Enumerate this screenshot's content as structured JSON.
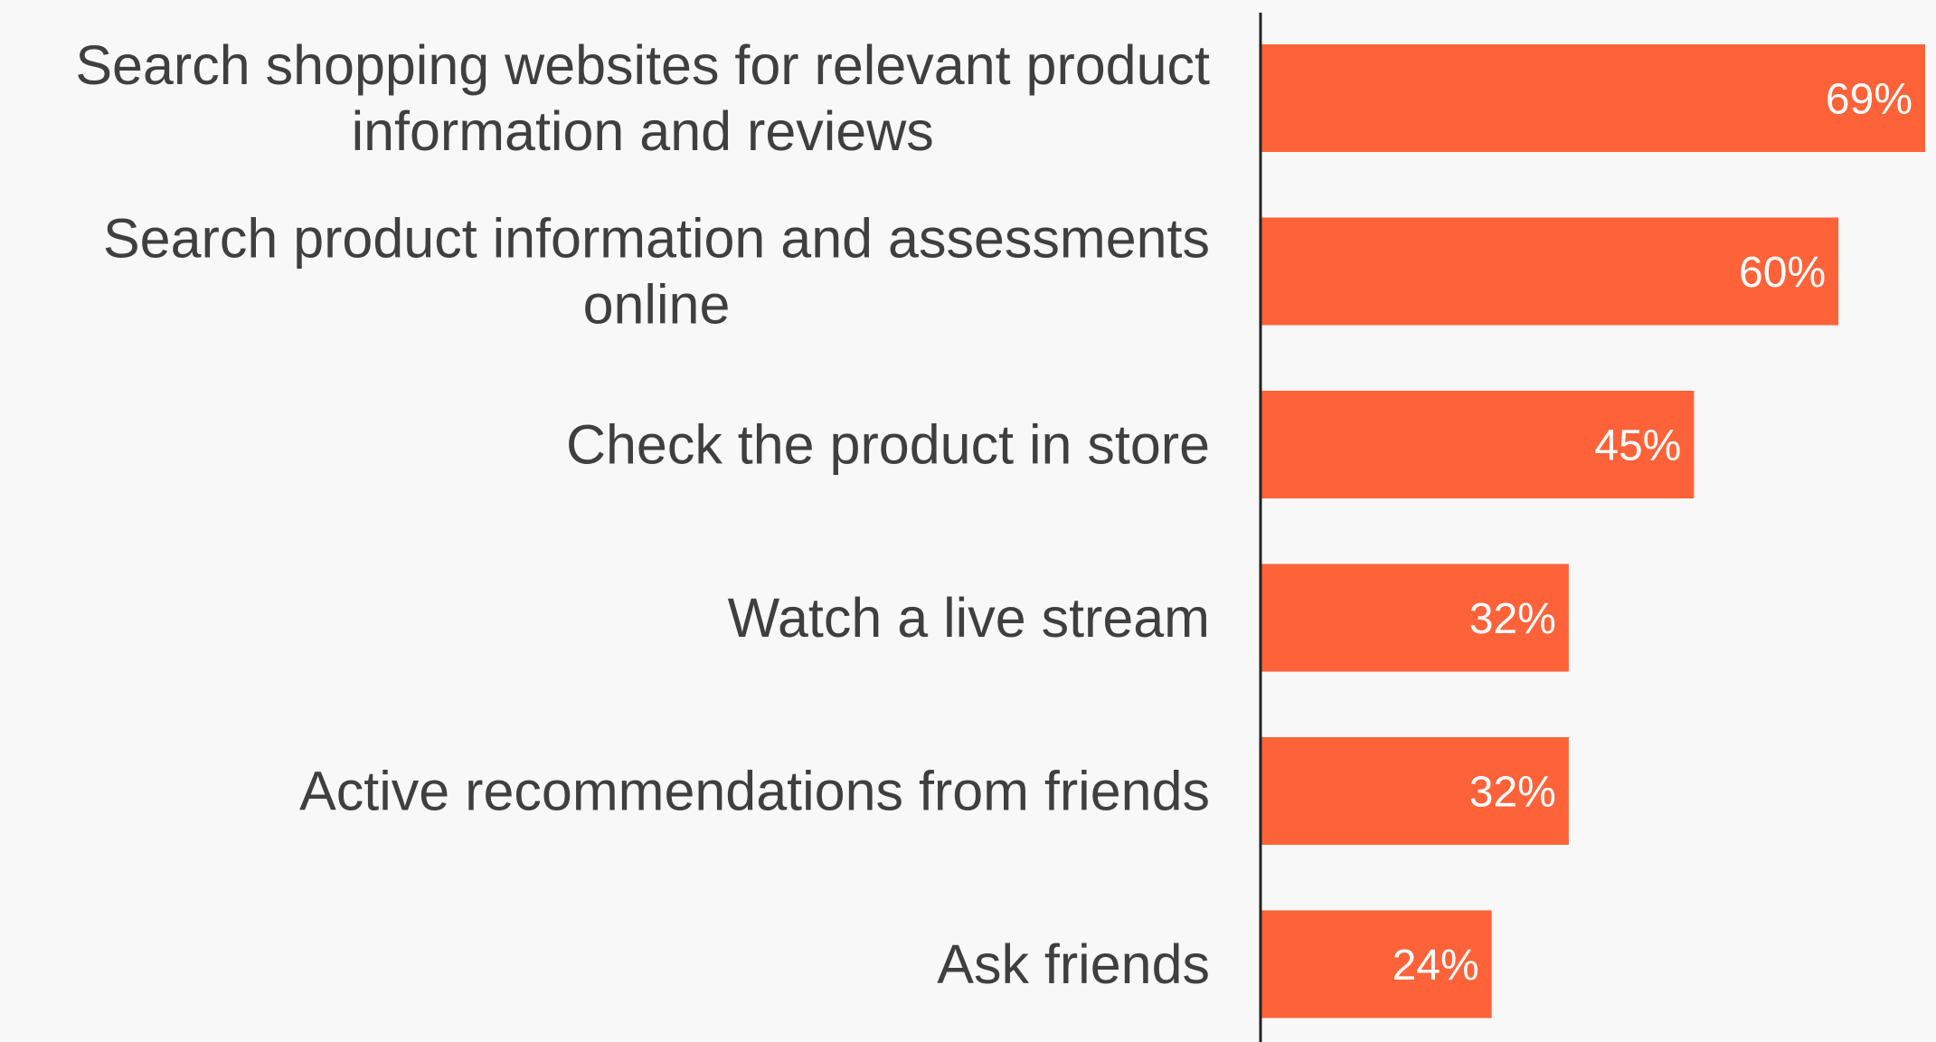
{
  "chart_data": {
    "type": "bar",
    "orientation": "horizontal",
    "categories": [
      [
        "Search shopping websites for relevant product",
        "information and reviews"
      ],
      [
        "Search product information and assessments",
        "online"
      ],
      [
        "Check the product in store"
      ],
      [
        "Watch a live stream"
      ],
      [
        "Active recommendations from friends"
      ],
      [
        "Ask friends"
      ]
    ],
    "values": [
      69,
      60,
      45,
      32,
      32,
      24
    ],
    "value_labels": [
      "69%",
      "60%",
      "45%",
      "32%",
      "32%",
      "24%"
    ],
    "title": "",
    "xlabel": "",
    "ylabel": "",
    "xlim": [
      0,
      69
    ],
    "grid": false,
    "legend": "none",
    "colors": {
      "bar": "#fd6239",
      "axis": "#222222",
      "category_text": "#3f3f3f",
      "value_text": "#ffffff",
      "background": "#f8f8f8"
    }
  }
}
